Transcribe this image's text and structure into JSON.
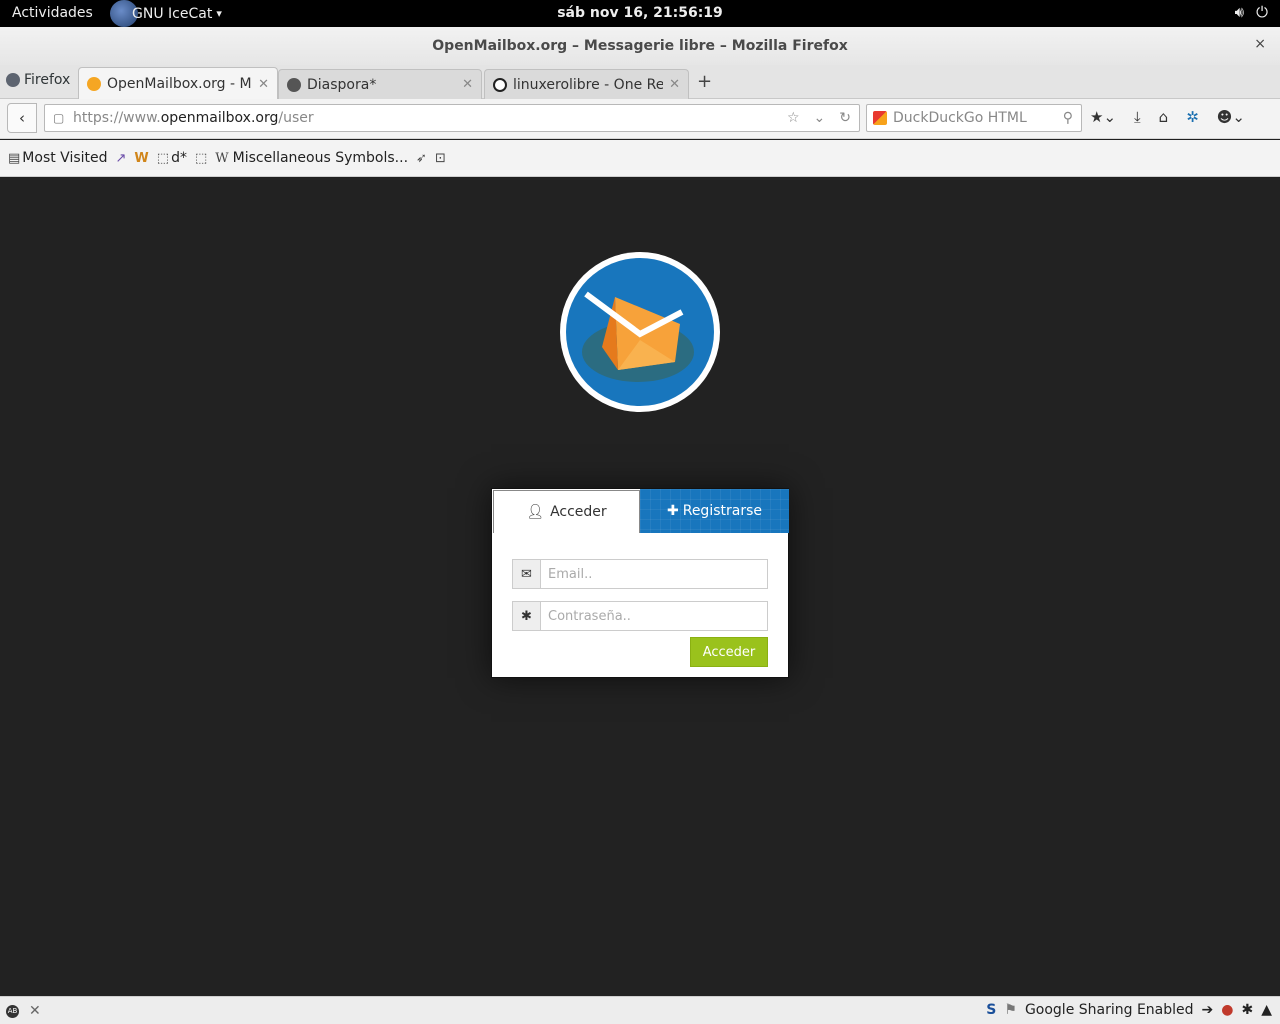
{
  "system_bar": {
    "activities": "Actividades",
    "app_name": "GNU IceCat",
    "app_arrow": "▾",
    "clock": "sáb nov 16, 21:56:19",
    "tray_icons": [
      "volume-icon",
      "power-icon"
    ]
  },
  "window": {
    "title": "OpenMailbox.org – Messagerie libre – Mozilla Firefox",
    "close": "×"
  },
  "tabs": {
    "firefox_button": "Firefox",
    "items": [
      {
        "label": "OpenMailbox.org - M...",
        "active": true
      },
      {
        "label": "Diaspora*",
        "active": false
      },
      {
        "label": "linuxerolibre - One Re...",
        "active": false
      }
    ],
    "new_tab": "+"
  },
  "navbar": {
    "url_prefix": "https://www.",
    "url_host": "openmailbox.org",
    "url_path": "/user",
    "search_placeholder": "DuckDuckGo HTML"
  },
  "bookmarks": {
    "most_visited": "Most Visited",
    "misc_symbols": "Miscellaneous Symbols...",
    "d_star": "d*"
  },
  "login": {
    "tab_login": "Acceder",
    "tab_register": "Registrarse",
    "email_placeholder": "Email..",
    "password_placeholder": "Contraseña..",
    "submit": "Acceder"
  },
  "status": {
    "sharing": "Google Sharing Enabled"
  },
  "colors": {
    "accent_blue": "#1876bd",
    "submit_green": "#9ac21c",
    "page_bg": "#222222"
  }
}
